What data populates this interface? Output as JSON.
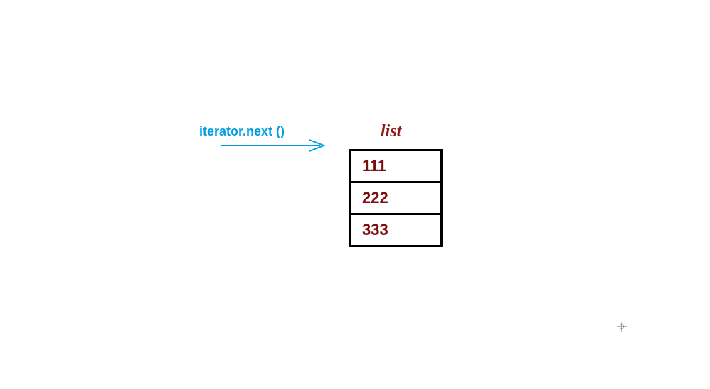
{
  "iterator": {
    "label": "iterator.next ()"
  },
  "list": {
    "title": "list",
    "items": [
      "111",
      "222",
      "333"
    ]
  }
}
